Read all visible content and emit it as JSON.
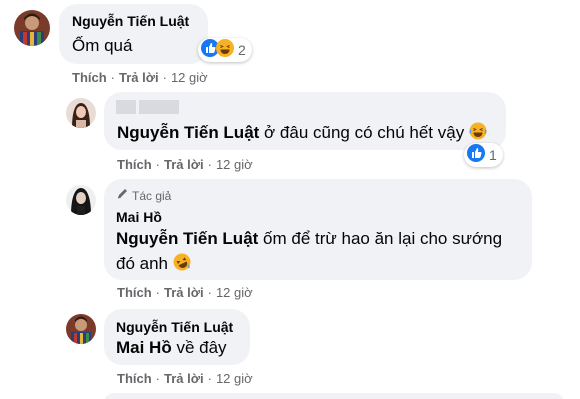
{
  "comments": [
    {
      "author": "Nguyễn Tiến Luật",
      "text": "Ốm quá",
      "reaction_count": "2",
      "actions": {
        "like": "Thích",
        "reply": "Trả lời",
        "time": "12 giờ"
      }
    },
    {
      "author": "",
      "mention": "Nguyễn Tiến Luật",
      "text": "ở đâu cũng có chú hết vậy",
      "reaction_count": "1",
      "actions": {
        "like": "Thích",
        "reply": "Trả lời",
        "time": "12 giờ"
      }
    },
    {
      "badge": "Tác giả",
      "author": "Mai Hồ",
      "mention": "Nguyễn Tiến Luật",
      "text_line1": "ốm để trừ hao ăn lại cho sướng",
      "text_line2": "đó anh",
      "actions": {
        "like": "Thích",
        "reply": "Trả lời",
        "time": "12 giờ"
      }
    },
    {
      "author": "Nguyễn Tiến Luật",
      "mention": "Mai Hồ",
      "text": "về đây",
      "actions": {
        "like": "Thích",
        "reply": "Trả lời",
        "time": "12 giờ"
      }
    }
  ],
  "colors": {
    "bubble": "#f0f2f5",
    "meta": "#65676b",
    "like_blue": "#1877f2",
    "haha_yellow": "#f7b125"
  }
}
